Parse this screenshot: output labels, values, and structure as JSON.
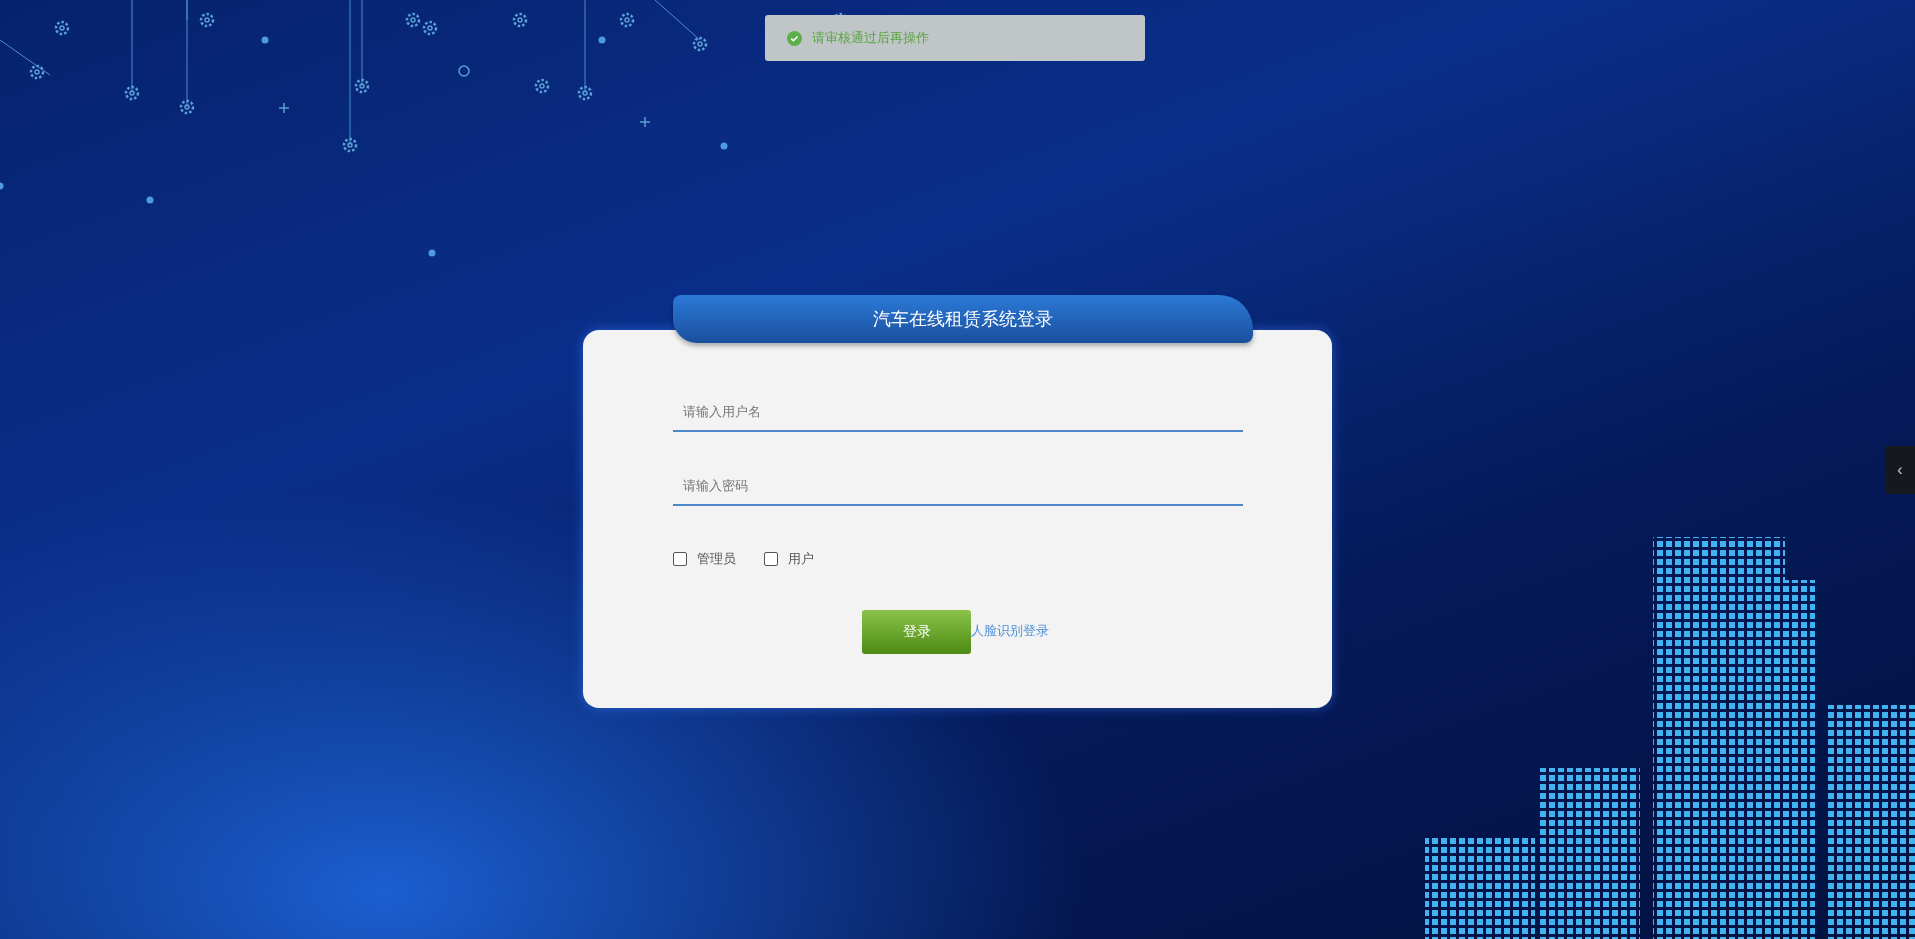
{
  "toast": {
    "kind": "success",
    "message": "请审核通过后再操作"
  },
  "login": {
    "title": "汽车在线租赁系统登录",
    "fields": [
      {
        "placeholder": "请输入用户名"
      },
      {
        "placeholder": "请输入密码"
      }
    ],
    "roles": [
      {
        "label": "管理员",
        "checked": false
      },
      {
        "label": "用户",
        "checked": false
      }
    ],
    "submit": "登录",
    "face_login_link": "人脸识别登录"
  },
  "side_tab": {
    "icon": "‹"
  }
}
